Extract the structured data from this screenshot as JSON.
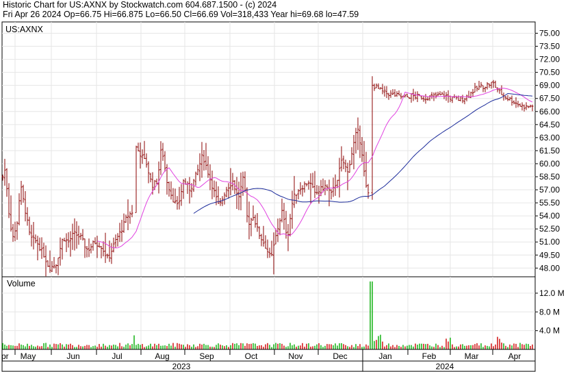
{
  "header": {
    "line1": "Historic Chart for US:AXNX by Stockwatch.com 604.687.1500 - (c) 2024",
    "line2": "Fri Apr 26 2024   Op=66.75   Hi=66.875   Lo=66.50   Cl=66.69   Vol=318,433   Year hi=69.68   lo=47.59"
  },
  "chart_data": [
    {
      "type": "ohlc",
      "panel": "price",
      "symbol_label": "US:AXNX",
      "y_ticks": [
        "75.00",
        "73.50",
        "72.00",
        "70.50",
        "69.00",
        "67.50",
        "66.00",
        "64.50",
        "63.00",
        "61.50",
        "60.00",
        "58.50",
        "57.00",
        "55.50",
        "54.00",
        "52.50",
        "51.00",
        "49.50",
        "48.00"
      ],
      "ylim": [
        47.0,
        76.3
      ],
      "x_months": [
        "pr",
        "May",
        "Jun",
        "Jul",
        "Aug",
        "Sep",
        "Oct",
        "Nov",
        "Dec",
        "Jan",
        "Feb",
        "Mar",
        "Apr"
      ],
      "x_years": [
        "2023",
        "2024"
      ],
      "series": [
        {
          "role": "price_bars",
          "color": "#8b0000"
        },
        {
          "role": "moving_average_short",
          "color": "#e040e0"
        },
        {
          "role": "moving_average_long",
          "color": "#1a2a9a"
        }
      ],
      "key_points": [
        {
          "month": "Apr 2023",
          "close": 58.5
        },
        {
          "month": "May 2023 low",
          "close": 48.0
        },
        {
          "month": "Jul 2023 high",
          "close": 62.0
        },
        {
          "month": "Oct 2023 low",
          "close": 49.0
        },
        {
          "month": "Dec 2023 high",
          "close": 64.5
        },
        {
          "month": "Jan 2024",
          "close": 69.0
        },
        {
          "month": "Mar 2024 high",
          "close": 69.68
        },
        {
          "month": "Apr 26 2024 close",
          "close": 66.69
        }
      ]
    },
    {
      "type": "bar",
      "panel": "volume",
      "title": "Volume",
      "y_ticks": [
        "12.0 M",
        "8.0 M",
        "4.0 M"
      ],
      "ylim": [
        0,
        15.5
      ],
      "unit": "M",
      "peak": {
        "month": "Dec 2023",
        "value": 14.5
      },
      "series": [
        {
          "role": "volume_bars",
          "colors": [
            "#cc0000",
            "#00aa00"
          ]
        }
      ]
    }
  ]
}
